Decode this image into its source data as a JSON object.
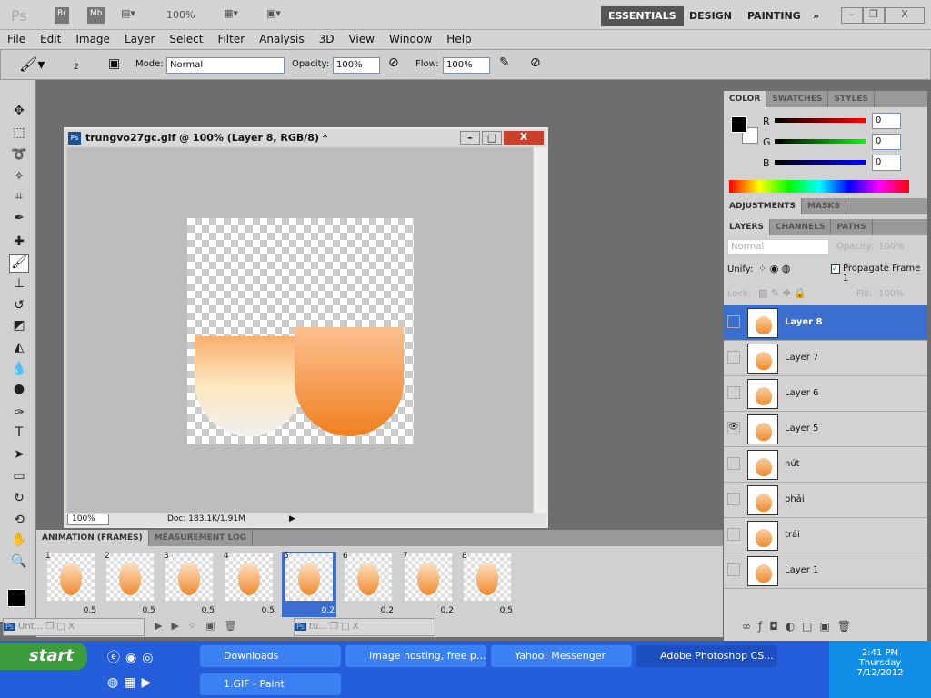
{
  "appbar": {
    "logo": "Ps",
    "bridge": "Br",
    "minibridge": "Mb",
    "zoom": "100%",
    "workspaces": [
      "ESSENTIALS",
      "DESIGN",
      "PAINTING"
    ],
    "more": "»"
  },
  "menu": [
    "File",
    "Edit",
    "Image",
    "Layer",
    "Select",
    "Filter",
    "Analysis",
    "3D",
    "View",
    "Window",
    "Help"
  ],
  "options": {
    "brush_size": "2",
    "mode_label": "Mode:",
    "mode": "Normal",
    "opacity_label": "Opacity:",
    "opacity": "100%",
    "flow_label": "Flow:",
    "flow": "100%"
  },
  "document": {
    "title": "trungvo27gc.gif @ 100% (Layer 8, RGB/8) *",
    "zoom": "100%",
    "doc_info": "Doc: 183.1K/1.91M"
  },
  "color_panel": {
    "tabs": [
      "COLOR",
      "SWATCHES",
      "STYLES"
    ],
    "r_label": "R",
    "g_label": "G",
    "b_label": "B",
    "r": "0",
    "g": "0",
    "b": "0"
  },
  "adjust_tabs": [
    "ADJUSTMENTS",
    "MASKS"
  ],
  "layers_panel": {
    "tabs": [
      "LAYERS",
      "CHANNELS",
      "PATHS"
    ],
    "blend": "Normal",
    "opacity_label": "Opacity:",
    "opacity": "100%",
    "unify_label": "Unify:",
    "propagate_label": "Propagate Frame 1",
    "lock_label": "Lock:",
    "fill_label": "Fill:",
    "fill": "100%",
    "layers": [
      {
        "name": "Layer 8",
        "selected": true,
        "visible": false
      },
      {
        "name": "Layer 7",
        "visible": false
      },
      {
        "name": "Layer 6",
        "visible": false
      },
      {
        "name": "Layer 5",
        "visible": true
      },
      {
        "name": "nứt",
        "visible": false
      },
      {
        "name": "phải",
        "visible": false
      },
      {
        "name": "trái",
        "visible": false
      },
      {
        "name": "Layer 1",
        "visible": false
      }
    ]
  },
  "animation": {
    "tabs": [
      "ANIMATION (FRAMES)",
      "MEASUREMENT LOG"
    ],
    "selected_frame": 5,
    "frames": [
      {
        "n": "1",
        "delay": "0.5"
      },
      {
        "n": "2",
        "delay": "0.5"
      },
      {
        "n": "3",
        "delay": "0.5"
      },
      {
        "n": "4",
        "delay": "0.5"
      },
      {
        "n": "5",
        "delay": "0.2"
      },
      {
        "n": "6",
        "delay": "0.2"
      },
      {
        "n": "7",
        "delay": "0.2"
      },
      {
        "n": "8",
        "delay": "0.5"
      }
    ]
  },
  "minimized": [
    {
      "label": "Unt..."
    },
    {
      "label": "tu..."
    }
  ],
  "taskbar": {
    "start": "start",
    "tasks": [
      "Downloads",
      "Image hosting, free p...",
      "Yahoo! Messenger",
      "Adobe Photoshop CS...",
      "1.GIF - Paint"
    ],
    "time": "2:41 PM",
    "day": "Thursday",
    "date": "7/12/2012"
  },
  "colors": {
    "selection": "#3a6ecf",
    "taskbar": "#245edb",
    "workspace": "#6e6e6e"
  }
}
